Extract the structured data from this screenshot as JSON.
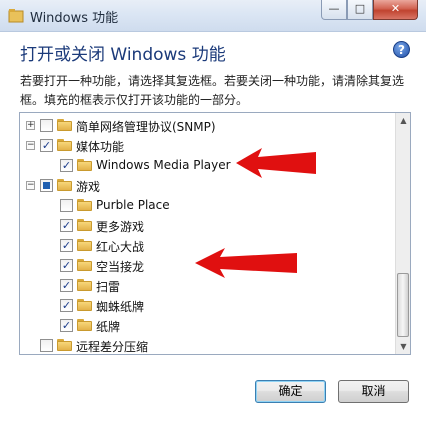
{
  "window": {
    "title": "Windows 功能",
    "minimize_glyph": "—",
    "maximize_glyph": "□",
    "close_glyph": "✕"
  },
  "header": {
    "heading": "打开或关闭 Windows 功能",
    "help_glyph": "?"
  },
  "description": "若要打开一种功能，请选择其复选框。若要关闭一种功能，请清除其复选框。填充的框表示仅打开该功能的一部分。",
  "tree": {
    "items": [
      {
        "label": "简单网络管理协议(SNMP)",
        "state": "unchecked",
        "expander": "+"
      },
      {
        "label": "媒体功能",
        "state": "checked",
        "expander": "−"
      },
      {
        "label": "Windows Media Player",
        "state": "checked",
        "expander": ""
      },
      {
        "label": "游戏",
        "state": "partial",
        "expander": "−"
      },
      {
        "label": "Purble Place",
        "state": "unchecked",
        "expander": ""
      },
      {
        "label": "更多游戏",
        "state": "checked",
        "expander": ""
      },
      {
        "label": "红心大战",
        "state": "checked",
        "expander": ""
      },
      {
        "label": "空当接龙",
        "state": "checked",
        "expander": ""
      },
      {
        "label": "扫雷",
        "state": "checked",
        "expander": ""
      },
      {
        "label": "蜘蛛纸牌",
        "state": "checked",
        "expander": ""
      },
      {
        "label": "纸牌",
        "state": "checked",
        "expander": ""
      },
      {
        "label": "远程差分压缩",
        "state": "unchecked",
        "expander": ""
      }
    ],
    "check_glyph": "✓"
  },
  "buttons": {
    "ok": "确定",
    "cancel": "取消"
  },
  "colors": {
    "arrow": "#e01010",
    "heading": "#1b3a7a"
  }
}
